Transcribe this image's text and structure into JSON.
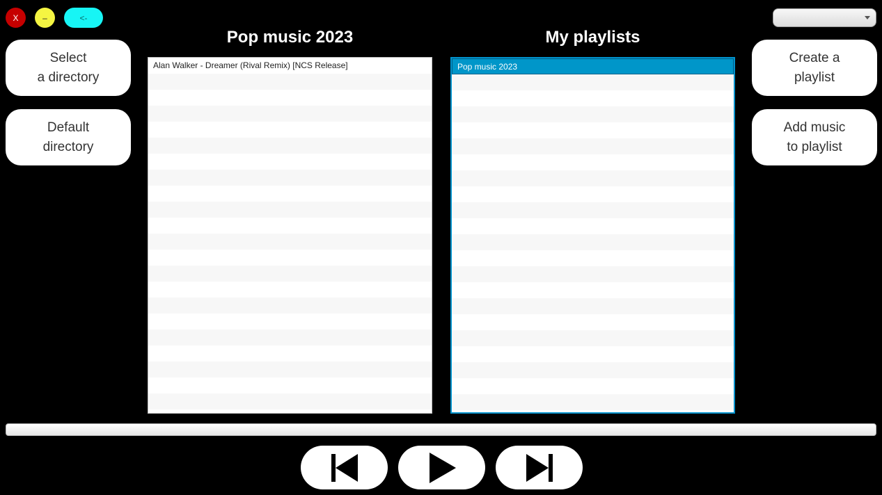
{
  "window": {
    "close_label": "X",
    "minimize_label": "–",
    "back_label": "<-"
  },
  "dropdown": {
    "selected": ""
  },
  "left_buttons": [
    {
      "label": "Select\na directory"
    },
    {
      "label": "Default\ndirectory"
    }
  ],
  "right_buttons": [
    {
      "label": "Create a\nplaylist"
    },
    {
      "label": "Add music\nto playlist"
    }
  ],
  "songs_panel": {
    "title": "Pop music 2023",
    "items": [
      "Alan Walker - Dreamer (Rival Remix) [NCS Release]"
    ]
  },
  "playlists_panel": {
    "title": "My playlists",
    "items": [
      "Pop music 2023"
    ],
    "selected_index": 0
  },
  "progress": {
    "value": 0
  },
  "transport": {
    "previous_icon": "skip-previous-icon",
    "play_icon": "play-icon",
    "next_icon": "skip-next-icon"
  },
  "colors": {
    "accent": "#0096c9",
    "close": "#c60000",
    "minimize": "#f5f542",
    "back": "#17f5f5"
  }
}
